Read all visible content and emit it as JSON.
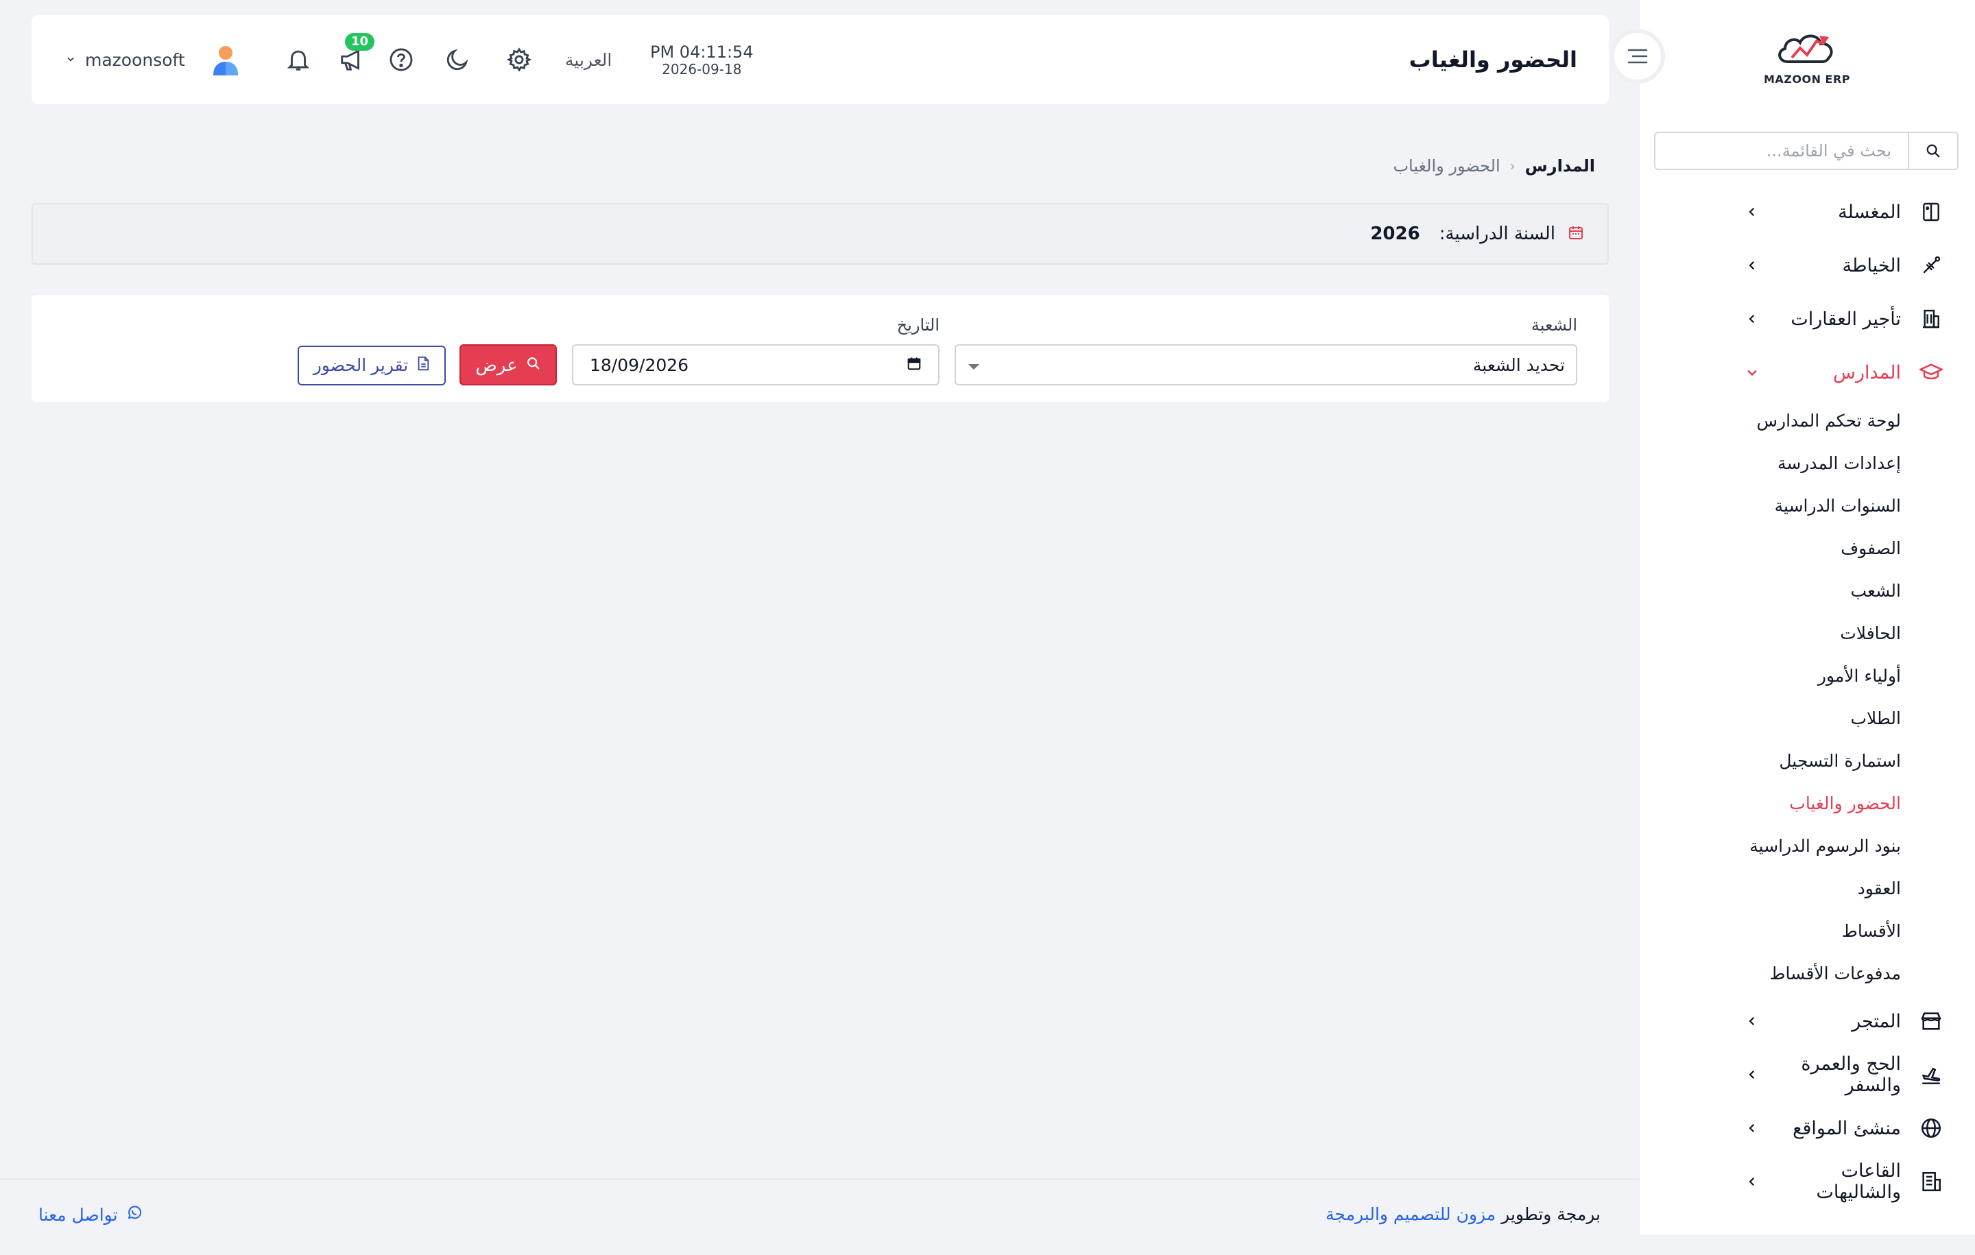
{
  "brand": {
    "name": "MAZOON ERP",
    "accent": "#e53e52"
  },
  "sidebar": {
    "search_placeholder": "بحث في القائمة...",
    "items": [
      {
        "label": "المغسلة",
        "icon": "laundry-icon",
        "expanded": false
      },
      {
        "label": "الخياطة",
        "icon": "tailoring-icon",
        "expanded": false
      },
      {
        "label": "تأجير العقارات",
        "icon": "building-icon",
        "expanded": false
      },
      {
        "label": "المدارس",
        "icon": "graduation-cap-icon",
        "expanded": true,
        "active": true,
        "children": [
          "لوحة تحكم المدارس",
          "إعدادات المدرسة",
          "السنوات الدراسية",
          "الصفوف",
          "الشعب",
          "الحافلات",
          "أولياء الأمور",
          "الطلاب",
          "استمارة التسجيل",
          "الحضور والغياب",
          "بنود الرسوم الدراسية",
          "العقود",
          "الأقساط",
          "مدفوعات الأقساط"
        ],
        "active_child": "الحضور والغياب"
      },
      {
        "label": "المتجر",
        "icon": "store-icon",
        "expanded": false
      },
      {
        "label": "الحج والعمرة والسفر",
        "icon": "plane-icon",
        "expanded": false
      },
      {
        "label": "منشئ المواقع",
        "icon": "globe-icon",
        "expanded": false
      },
      {
        "label": "القاعات والشاليهات",
        "icon": "hall-icon",
        "expanded": false
      }
    ]
  },
  "header": {
    "title": "الحضور والغياب",
    "time": "PM 04:11:54",
    "date": "2026-09-18",
    "language": "العربية",
    "notifications_count": "10",
    "username": "mazoonsoft"
  },
  "breadcrumb": {
    "root": "المدارس",
    "current": "الحضور والغياب"
  },
  "academic_year": {
    "label": "السنة الدراسية:",
    "value": "2026"
  },
  "filters": {
    "section_label": "الشعبة",
    "section_value": "تحديد الشعبة",
    "date_label": "التاريخ",
    "date_value": "18/09/2026",
    "show_button": "عرض",
    "report_button": "تقرير الحضور"
  },
  "footer": {
    "credit_prefix": "برمجة وتطوير",
    "credit_link": "مزون للتصميم والبرمجة",
    "contact": "تواصل معنا"
  }
}
